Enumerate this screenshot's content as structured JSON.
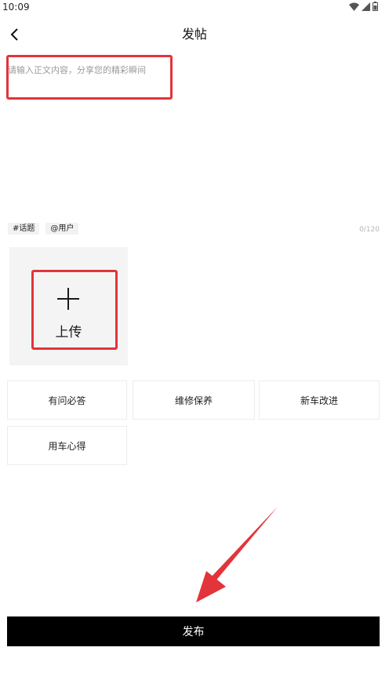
{
  "status_bar": {
    "time": "10:09",
    "icons": [
      "wifi-icon",
      "signal-icon",
      "battery-icon"
    ]
  },
  "header": {
    "back_icon": "chevron-left-icon",
    "title": "发帖"
  },
  "editor": {
    "value": "",
    "placeholder": "请输入正文内容，分享您的精彩瞬间",
    "char_count": "0/120"
  },
  "tags": [
    {
      "label": "#话题"
    },
    {
      "label": "@用户"
    }
  ],
  "upload": {
    "icon": "plus-icon",
    "label": "上传"
  },
  "categories": [
    {
      "label": "有问必答"
    },
    {
      "label": "维修保养"
    },
    {
      "label": "新车改进"
    },
    {
      "label": "用车心得"
    }
  ],
  "publish": {
    "label": "发布"
  },
  "colors": {
    "annotation_red": "#e2343a",
    "publish_bg": "#000000",
    "upload_bg": "#f4f4f4",
    "tag_bg": "#f2f2f2"
  }
}
